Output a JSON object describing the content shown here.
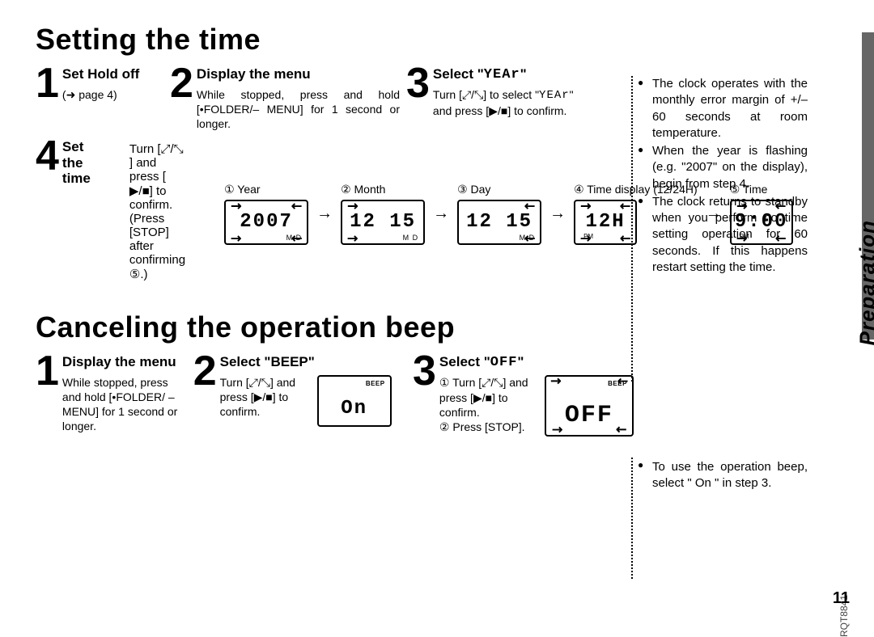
{
  "page": {
    "number": "11",
    "doc_code": "RQT8841",
    "side_label": "Preparation"
  },
  "section1": {
    "title": "Setting the time",
    "steps": {
      "s1": {
        "num": "1",
        "title": "Set Hold off",
        "body": "(➜ page 4)"
      },
      "s2": {
        "num": "2",
        "title": "Display the menu",
        "body": "While stopped, press and hold [•FOLDER/– MENU] for 1 second or longer."
      },
      "s3": {
        "num": "3",
        "title_prefix": "Select \"",
        "title_seg": "YEAr",
        "title_suffix": "\"",
        "body1": "Turn [",
        "body_icon1": "⤢/⤡",
        "body2": "] to select \"",
        "body_seg": "YEAr",
        "body3": "\" and press [",
        "body_icon2": "▶/■",
        "body4": "] to confirm."
      },
      "s4": {
        "num": "4",
        "title": "Set the time",
        "desc_a": "Turn [",
        "desc_icon1": "⤢/⤡",
        "desc_b": "] and press [",
        "desc_icon2": "▶/■",
        "desc_c": "] to confirm. (Press [STOP] after confirming ⑤.)",
        "items": [
          {
            "label": "① Year",
            "display": "2007",
            "sub": "M D",
            "flash": true
          },
          {
            "label": "② Month",
            "display": "12 15",
            "sub": "M D",
            "flash_left": true
          },
          {
            "label": "③ Day",
            "display": "12 15",
            "sub": "M D",
            "flash_right": true
          },
          {
            "label": "④ Time display (12/24H)",
            "display": "12H",
            "narrow": true,
            "pm": "PM",
            "flash": true
          },
          {
            "label": "⑤ Time",
            "display": "9:00",
            "narrow": true,
            "pm": "PM",
            "flash": true
          }
        ]
      }
    },
    "notes": [
      "The clock operates with the monthly error margin of +/– 60 seconds at room temperature.",
      "When the year is flashing (e.g. \"2007\" on the display), begin from step 4.",
      "The clock returns to standby when you perform no time setting operation for 60 seconds. If this happens restart setting the time."
    ]
  },
  "section2": {
    "title": "Canceling the operation beep",
    "steps": {
      "s1": {
        "num": "1",
        "title": "Display the menu",
        "body": "While stopped, press and hold [•FOLDER/ – MENU] for 1 second or longer."
      },
      "s2": {
        "num": "2",
        "title": "Select \"BEEP\"",
        "body1": "Turn [",
        "body_icon1": "⤢/⤡",
        "body2": "] and press [",
        "body_icon2": "▶/■",
        "body3": "] to confirm.",
        "lcd_label": "BEEP",
        "lcd_text": "On"
      },
      "s3": {
        "num": "3",
        "title_prefix": "Select \"",
        "title_seg": "OFF",
        "title_suffix": "\"",
        "line1a": "① Turn [",
        "line1_icon": "⤢/⤡",
        "line1b": "] and press [",
        "line1_icon2": "▶/■",
        "line1c": "] to confirm.",
        "line2": "② Press [STOP].",
        "lcd_label": "BEEP",
        "lcd_text": "OFF"
      }
    },
    "notes": [
      "To use the operation beep, select \" On \" in step 3."
    ]
  }
}
